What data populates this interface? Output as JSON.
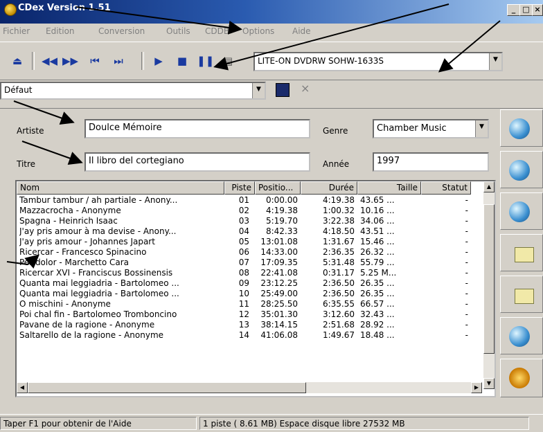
{
  "window": {
    "title": "CDex Version 1.51"
  },
  "menu": [
    "Fichier",
    "Edition",
    "Conversion",
    "Outils",
    "CDDB",
    "Options",
    "Aide"
  ],
  "toolbar": {
    "drive": "LITE-ON DVDRW SOHW-1633S"
  },
  "profile": {
    "value": "Défaut"
  },
  "info": {
    "artist_label": "Artiste",
    "artist_value": "Doulce Mémoire",
    "title_label": "Titre",
    "title_value": "Il libro del cortegiano",
    "genre_label": "Genre",
    "genre_value": "Chamber Music",
    "year_label": "Année",
    "year_value": "1997"
  },
  "list": {
    "headers": [
      "Nom",
      "Piste",
      "Positio...",
      "Durée",
      "Taille",
      "Statut"
    ],
    "rows": [
      [
        "Tambur tambur / ah partiale - Anony...",
        "01",
        "0:00.00",
        "4:19.38",
        "43.65 ...",
        "-"
      ],
      [
        "Mazzacrocha - Anonyme",
        "02",
        "4:19.38",
        "1:00.32",
        "10.16 ...",
        "-"
      ],
      [
        "Spagna - Heinrich Isaac",
        "03",
        "5:19.70",
        "3:22.38",
        "34.06 ...",
        "-"
      ],
      [
        "J'ay pris amour à ma devise - Anony...",
        "04",
        "8:42.33",
        "4:18.50",
        "43.51 ...",
        "-"
      ],
      [
        "J'ay pris amour - Johannes Japart",
        "05",
        "13:01.08",
        "1:31.67",
        "15.46 ...",
        "-"
      ],
      [
        "Ricercar - Francesco Spinacino",
        "06",
        "14:33.00",
        "2:36.35",
        "26.32 ...",
        "-"
      ],
      [
        "Per dolor - Marchetto Cara",
        "07",
        "17:09.35",
        "5:31.48",
        "55.79 ...",
        "-"
      ],
      [
        "Ricercar XVI - Franciscus Bossinensis",
        "08",
        "22:41.08",
        "0:31.17",
        "5.25 M...",
        "-"
      ],
      [
        "Quanta mai leggiadria - Bartolomeo ...",
        "09",
        "23:12.25",
        "2:36.50",
        "26.35 ...",
        "-"
      ],
      [
        "Quanta mai leggiadria - Bartolomeo ...",
        "10",
        "25:49.00",
        "2:36.50",
        "26.35 ...",
        "-"
      ],
      [
        "O mischini - Anonyme",
        "11",
        "28:25.50",
        "6:35.55",
        "66.57 ...",
        "-"
      ],
      [
        "Poi chal fin - Bartolomeo Tromboncino",
        "12",
        "35:01.30",
        "3:12.60",
        "32.43 ...",
        "-"
      ],
      [
        "Pavane de la ragione - Anonyme",
        "13",
        "38:14.15",
        "2:51.68",
        "28.92 ...",
        "-"
      ],
      [
        "Saltarello de la ragione - Anonyme",
        "14",
        "41:06.08",
        "1:49.67",
        "18.48 ...",
        "-"
      ]
    ]
  },
  "status": {
    "help": "Taper F1 pour obtenir de l'Aide",
    "info": "1 piste ( 8.61 MB) Espace disque libre 27532 MB"
  },
  "colors": {
    "title_start": "#0a246a",
    "title_end": "#a6caf0",
    "face": "#d4d0c8"
  }
}
